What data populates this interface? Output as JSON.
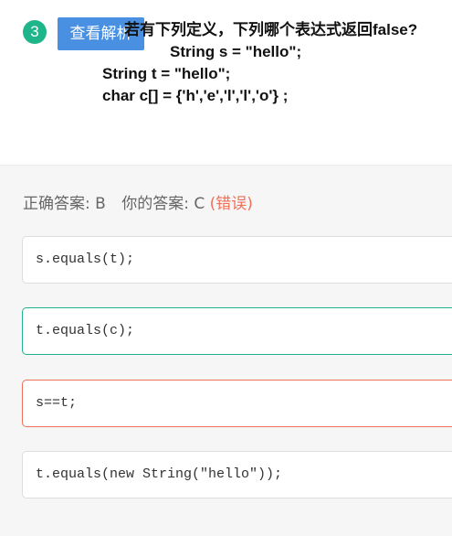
{
  "question": {
    "number": "3",
    "view_analysis_label": "查看解析",
    "lines": [
      "若有下列定义，下列哪个表达式返回false?",
      "String s = \"hello\";",
      "String t = \"hello\";",
      "char c[] = {'h','e','l','l','o'} ;"
    ]
  },
  "result": {
    "correct_label": "正确答案:",
    "correct_value": "B",
    "your_label": "你的答案:",
    "your_value": "C",
    "status": "(错误)"
  },
  "options": [
    {
      "code": "s.equals(t);",
      "state": "normal"
    },
    {
      "code": "t.equals(c);",
      "state": "correct"
    },
    {
      "code": "s==t;",
      "state": "wrong"
    },
    {
      "code": "t.equals(new String(\"hello\"));",
      "state": "normal"
    }
  ],
  "colors": {
    "badge": "#1fb58a",
    "button": "#4a90e2",
    "correct_border": "#22b38a",
    "wrong_border": "#ef6f57",
    "wrong_text": "#ef6f57",
    "panel_background": "#f6f6f6"
  }
}
